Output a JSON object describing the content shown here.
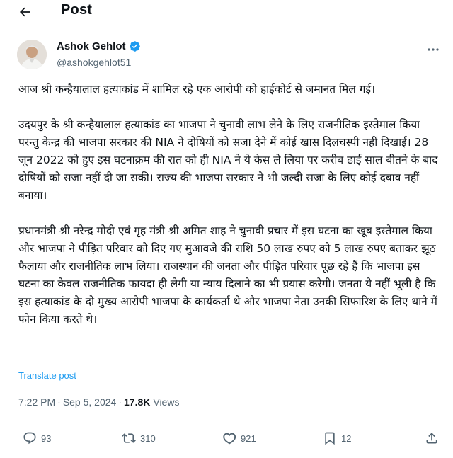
{
  "header": {
    "title": "Post"
  },
  "author": {
    "name": "Ashok Gehlot",
    "handle": "@ashokgehlot51"
  },
  "tweet": {
    "paragraphs": [
      "आज श्री कन्हैयालाल हत्याकांड में शामिल रहे एक आरोपी को हाईकोर्ट से जमानत मिल गई।",
      "उदयपुर के श्री कन्हैयालाल हत्याकांड का भाजपा ने चुनावी लाभ लेने के लिए राजनीतिक इस्तेमाल किया परन्तु केन्द्र की भाजपा सरकार की NIA ने दोषियों को सजा देने में कोई खास दिलचस्पी नहीं दिखाई। 28 जून 2022 को हुए इस घटनाक्रम की रात को ही NIA ने ये केस ले लिया पर करीब ढाई साल बीतने के बाद दोषियों को सजा नहीं दी जा सकी। राज्य की भाजपा सरकार ने भी जल्दी सजा के लिए कोई दबाव नहीं बनाया।",
      "प्रधानमंत्री श्री नरेन्द्र मोदी एवं गृह मंत्री श्री अमित शाह ने चुनावी प्रचार में इस घटना का खूब इस्तेमाल किया और भाजपा ने पीड़ित परिवार को दिए गए मुआवजे की राशि 50 लाख रुपए को 5 लाख रुपए बताकर झूठ फैलाया और राजनीतिक लाभ लिया। राजस्थान की जनता और पीड़ित परिवार पूछ रहे हैं कि भाजपा इस घटना का केवल राजनीतिक फायदा ही लेगी या न्याय दिलाने का भी प्रयास करेगी। जनता ये नहीं भूली है कि इस हत्याकांड के दो मुख्य आरोपी भाजपा के कार्यकर्ता थे और भाजपा नेता उनकी सिफारिश के लिए थाने में फोन किया करते थे।"
    ],
    "translate_label": "Translate post",
    "time": "7:22 PM",
    "date": "Sep 5, 2024",
    "separator": "·",
    "views_count": "17.8K",
    "views_label": "Views"
  },
  "actions": {
    "replies": "93",
    "reposts": "310",
    "likes": "921",
    "bookmarks": "12"
  },
  "colors": {
    "accent": "#1d9bf0",
    "muted": "#536471",
    "text": "#0f1419"
  }
}
